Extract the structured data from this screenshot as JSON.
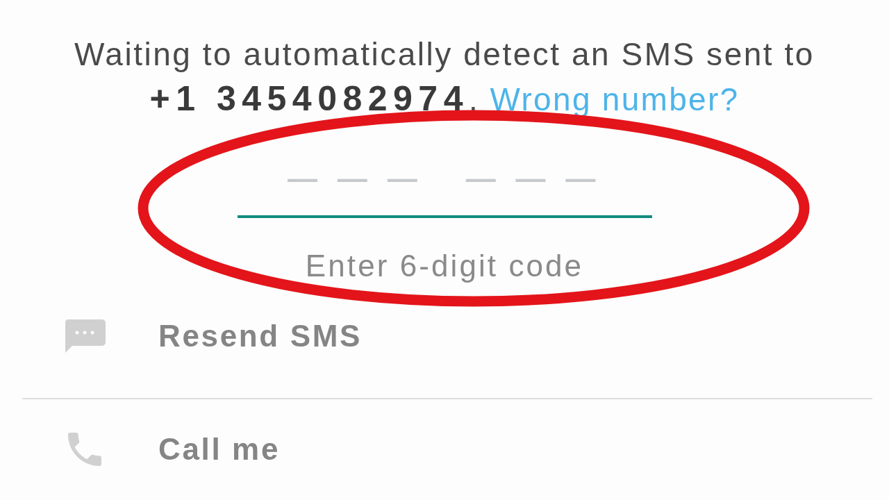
{
  "message": {
    "text": "Waiting to automatically detect an SMS sent to **+1 3454082974**.",
    "link": "Wrong number?"
  },
  "code_field": {
    "placeholder": "— — —   — — —",
    "focused": true,
    "hint": "Enter 6-digit code"
  },
  "options": [
    {
      "kind": "sms",
      "label": "Resend SMS"
    },
    {
      "kind": "call",
      "label": "Call me"
    }
  ]
}
